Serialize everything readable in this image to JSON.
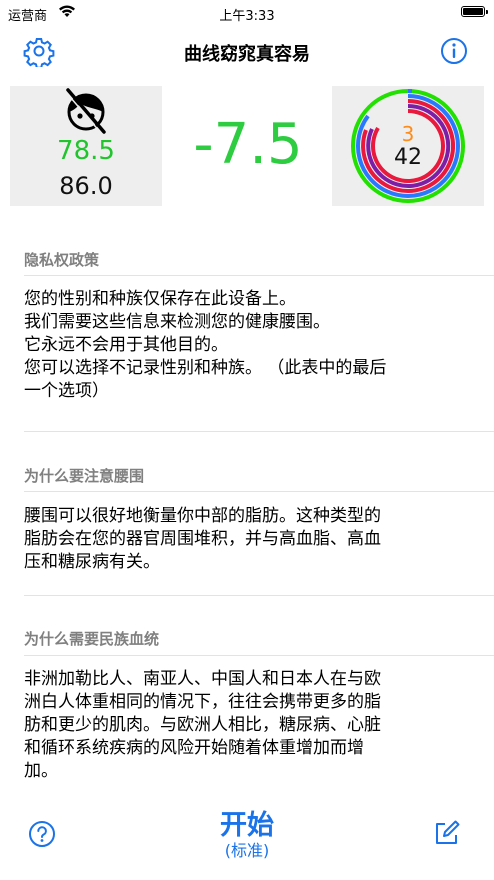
{
  "status_bar": {
    "carrier": "运营商",
    "time": "上午3:33"
  },
  "nav": {
    "title": "曲线窈窕真容易"
  },
  "dashboard": {
    "left_main_value": "78.5",
    "left_sub_value": "86.0",
    "center_value": "-7.5",
    "ring_top_value": "3",
    "ring_bottom_value": "42",
    "colors": {
      "good": "#2ecc40",
      "warn": "#ff8c1a",
      "ring_red": "#e8193c",
      "ring_purple": "#7d1fa6",
      "ring_green": "#22e000",
      "ring_blue": "#2979ff"
    }
  },
  "sections": [
    {
      "header": "隐私权政策",
      "lines": [
        "您的性别和种族仅保存在此设备上。",
        "我们需要这些信息来检测您的健康腰围。",
        "它永远不会用于其他目的。",
        "您可以选择不记录性别和种族。 （此表中的最后",
        "一个选项）"
      ]
    },
    {
      "header": "为什么要注意腰围",
      "lines": [
        "腰围可以很好地衡量你中部的脂肪。这种类型的",
        "脂肪会在您的器官周围堆积，并与高血脂、高血",
        "压和糖尿病有关。"
      ]
    },
    {
      "header": "为什么需要民族血统",
      "lines": [
        "非洲加勒比人、南亚人、中国人和日本人在与欧",
        "洲白人体重相同的情况下，往往会携带更多的脂",
        "肪和更少的肌肉。与欧洲人相比，糖尿病、心脏",
        "和循环系统疾病的风险开始随着体重增加而增",
        "加。"
      ]
    }
  ],
  "bottom": {
    "start_label": "开始",
    "mode_label": "(标准)"
  },
  "icons": {
    "settings": "gear-icon",
    "info": "info-icon",
    "help": "question-icon",
    "edit": "edit-icon",
    "avatar": "no-face-icon"
  }
}
